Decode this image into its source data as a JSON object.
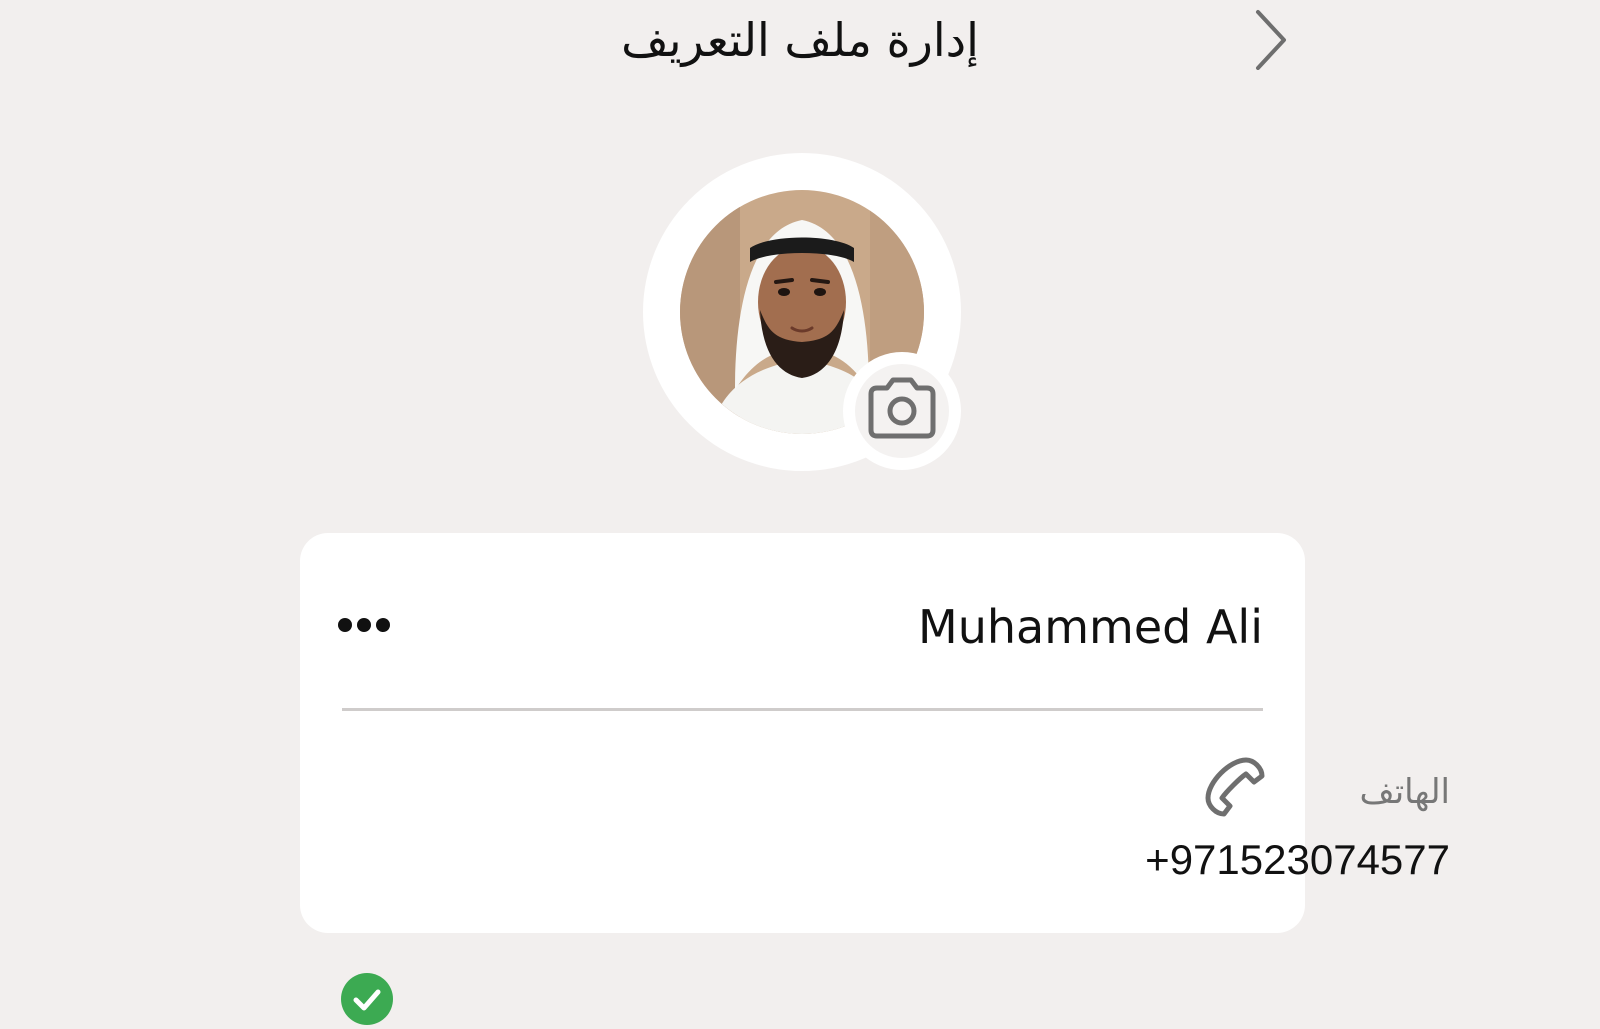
{
  "header": {
    "title": "إدارة ملف التعريف",
    "back_icon": "chevron-right-icon"
  },
  "profile": {
    "avatar_icon": "profile-photo",
    "camera_icon": "camera-icon",
    "name": "Muhammed Ali",
    "more_icon": "more-horizontal-icon"
  },
  "phone": {
    "icon": "phone-icon",
    "label": "الهاتف",
    "number": "+971523074577",
    "verified_icon": "check-circle-icon",
    "verified_color": "#3caa52"
  }
}
